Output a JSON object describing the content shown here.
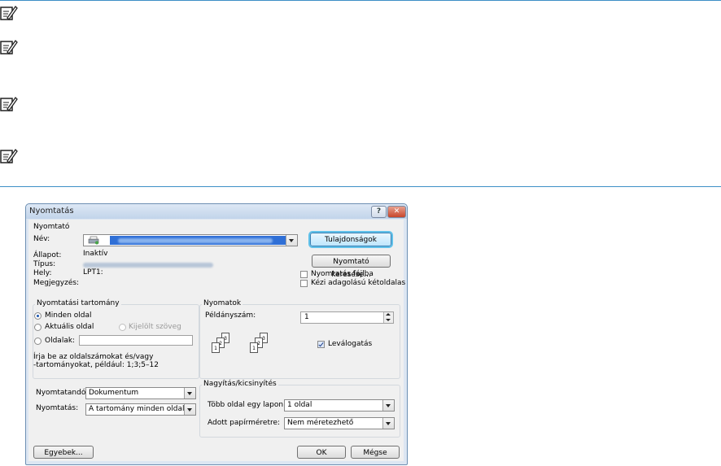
{
  "dialog": {
    "title": "Nyomtatás",
    "help_label": "?",
    "close_label": "✕",
    "printer_group": {
      "title": "Nyomtató",
      "name_label": "Név:",
      "status_label": "Állapot:",
      "status_value": "Inaktív",
      "type_label": "Típus:",
      "where_label": "Hely:",
      "where_value": "LPT1:",
      "comment_label": "Megjegyzés:",
      "properties_button": "Tulajdonságok",
      "find_printer_button": "Nyomtató keresése...",
      "print_to_file_label": "Nyomtatás fájlba",
      "manual_duplex_label": "Kézi adagolású kétoldalas"
    },
    "range_group": {
      "title": "Nyomtatási tartomány",
      "all_pages": "Minden oldal",
      "current_page": "Aktuális oldal",
      "selection": "Kijelölt szöveg",
      "pages_label": "Oldalak:",
      "hint": "Írja be az oldalszámokat és/vagy\n-tartományokat, például: 1;3;5–12"
    },
    "copies_group": {
      "title": "Nyomatok",
      "copies_label": "Példányszám:",
      "copies_value": "1",
      "collate_label": "Leválogatás"
    },
    "print_what_label": "Nyomtatandó:",
    "print_what_value": "Dokumentum",
    "print_label": "Nyomtatás:",
    "print_value": "A tartomány minden oldala",
    "zoom_group": {
      "title": "Nagyítás/kicsinyítés",
      "pages_per_sheet_label": "Több oldal egy lapon:",
      "pages_per_sheet_value": "1 oldal",
      "scale_label": "Adott papírméretre:",
      "scale_value": "Nem méretezhető"
    },
    "options_button": "Egyebek...",
    "ok_button": "OK",
    "cancel_button": "Mégse"
  },
  "colors": {
    "accent_line": "#3d8fc6",
    "selection_blue": "#2f6fd6"
  }
}
